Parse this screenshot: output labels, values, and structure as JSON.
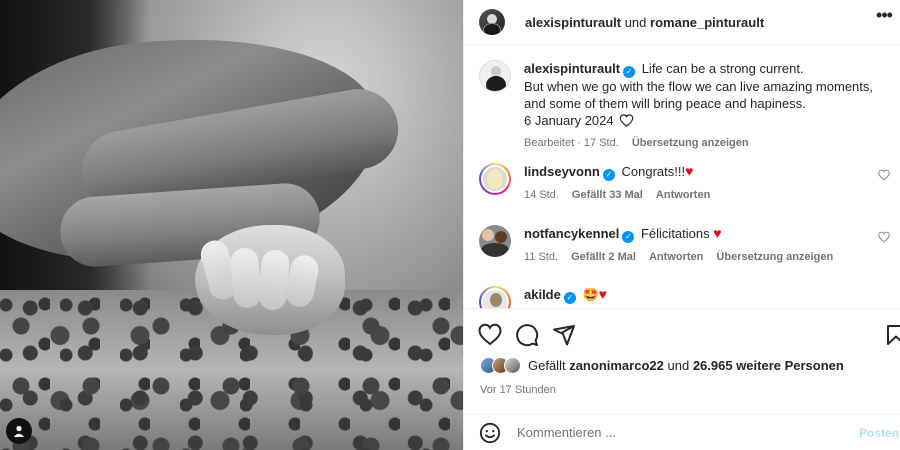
{
  "header": {
    "user1": "alexispinturault",
    "connector": "und",
    "user2": "romane_pinturault",
    "more": "•••"
  },
  "caption": {
    "username": "alexispinturault",
    "line1": "Life can be a strong current.",
    "line2": "But when we go with the flow we can live amazing moments, and some of them will bring peace and hapiness.",
    "date": "6 January 2024",
    "edited": "Bearbeitet · 17 Std.",
    "translate": "Übersetzung anzeigen"
  },
  "comments": [
    {
      "username": "lindseyvonn",
      "text": "Congrats!!!",
      "time": "14 Std.",
      "likes": "Gefällt 33 Mal",
      "reply": "Antworten",
      "translate": ""
    },
    {
      "username": "notfancykennel",
      "text": "Félicitations",
      "time": "11 Std.",
      "likes": "Gefällt 2 Mal",
      "reply": "Antworten",
      "translate": "Übersetzung anzeigen"
    },
    {
      "username": "akilde",
      "text": "",
      "time": "",
      "likes": "",
      "reply": "",
      "translate": ""
    }
  ],
  "likes": {
    "prefix": "Gefällt",
    "user": "zanonimarco22",
    "middle": "und",
    "others": "26.965 weitere Personen"
  },
  "time_ago": "Vor 17 Stunden",
  "comment_input": {
    "placeholder": "Kommentieren ...",
    "post_label": "Posten"
  },
  "colors": {
    "verified": "#0095f6",
    "heart": "#e0101e",
    "muted": "#737373",
    "post_button_disabled": "#b2dffc"
  },
  "icons": [
    "heart-icon",
    "comment-icon",
    "share-icon",
    "bookmark-icon",
    "emoji-icon",
    "verified-badge-icon",
    "more-options-icon",
    "user-tag-icon"
  ]
}
